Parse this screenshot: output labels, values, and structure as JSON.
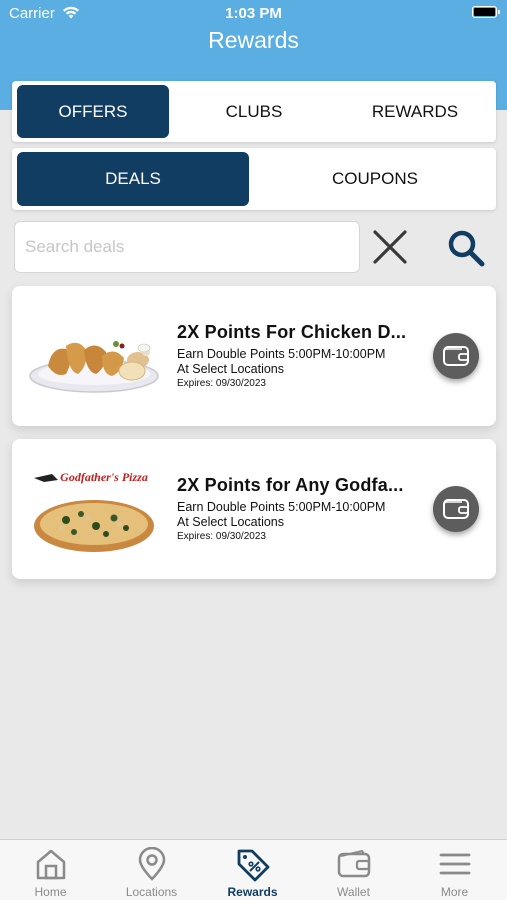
{
  "status_bar": {
    "carrier": "Carrier",
    "time": "1:03 PM"
  },
  "nav": {
    "title": "Rewards"
  },
  "top_tabs": [
    {
      "label": "OFFERS",
      "active": true
    },
    {
      "label": "CLUBS",
      "active": false
    },
    {
      "label": "REWARDS",
      "active": false
    }
  ],
  "sub_tabs": [
    {
      "label": "DEALS",
      "active": true
    },
    {
      "label": "COUPONS",
      "active": false
    }
  ],
  "search": {
    "placeholder": "Search deals",
    "value": ""
  },
  "deals": [
    {
      "title": "2X Points For Chicken D...",
      "line1": "Earn Double Points 5:00PM-10:00PM",
      "line2": "At Select Locations",
      "expires": "Expires: 09/30/2023",
      "image": "chicken-strips-plate"
    },
    {
      "title": "2X Points for Any Godfa...",
      "line1": "Earn Double Points 5:00PM-10:00PM",
      "line2": "At Select Locations",
      "expires": "Expires: 09/30/2023",
      "image": "godfathers-pizza",
      "brand_text": "Godfather's Pizza"
    }
  ],
  "bottom_tabs": [
    {
      "label": "Home",
      "icon": "home-icon",
      "active": false
    },
    {
      "label": "Locations",
      "icon": "location-pin-icon",
      "active": false
    },
    {
      "label": "Rewards",
      "icon": "percent-tag-icon",
      "active": true
    },
    {
      "label": "Wallet",
      "icon": "wallet-icon",
      "active": false
    },
    {
      "label": "More",
      "icon": "hamburger-menu-icon",
      "active": false
    }
  ],
  "colors": {
    "header_blue": "#5aaee2",
    "navy_active": "#123d63",
    "background": "#e9e9e9",
    "wallet_button": "#5d5d5d"
  }
}
